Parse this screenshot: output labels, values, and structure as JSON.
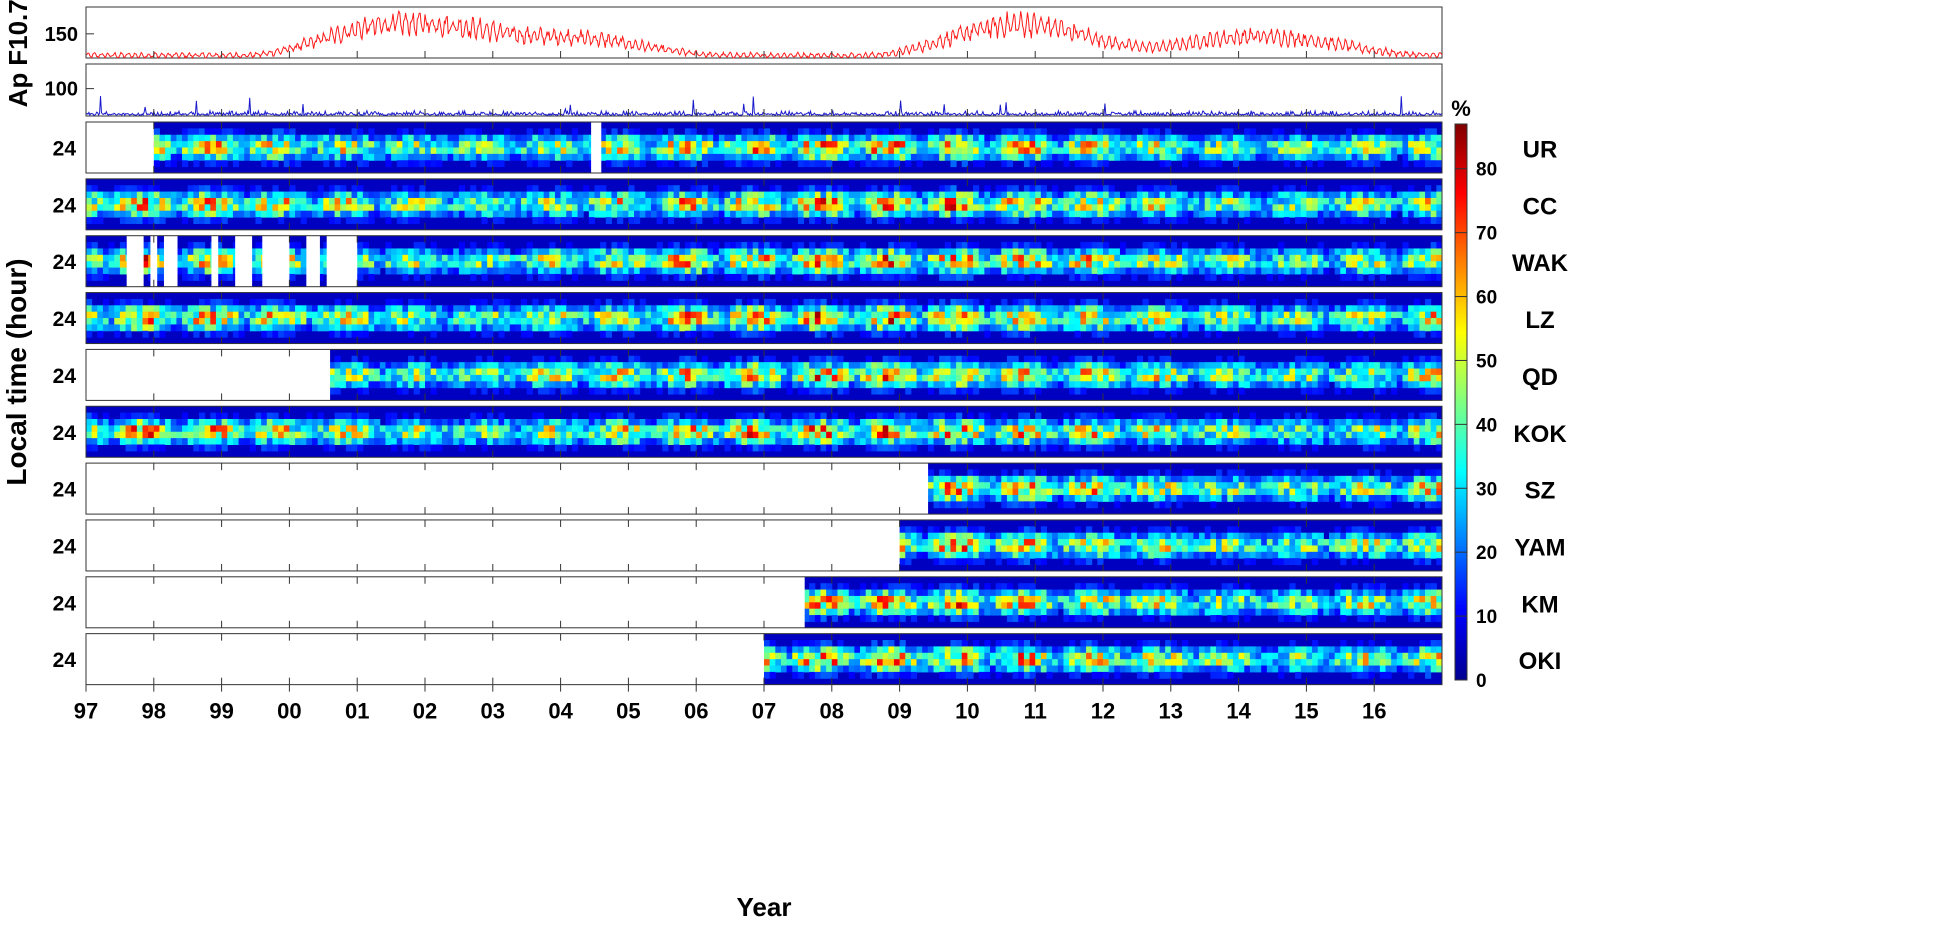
{
  "chart_data": {
    "type": "heatmap",
    "x_axis": {
      "label": "Year",
      "ticks": [
        "97",
        "98",
        "99",
        "00",
        "01",
        "02",
        "03",
        "04",
        "05",
        "06",
        "07",
        "08",
        "09",
        "10",
        "11",
        "12",
        "13",
        "14",
        "15",
        "16"
      ],
      "range": [
        1997.0,
        2017.0
      ]
    },
    "ylabel": "Local time (hour)",
    "top_panels": [
      {
        "label": "F10.7",
        "tick_label": "150",
        "tick_value": 150,
        "ylim": [
          60,
          250
        ],
        "color": "#ff1a1a"
      },
      {
        "label": "Ap",
        "tick_label": "100",
        "tick_value": 100,
        "ylim": [
          0,
          190
        ],
        "color": "#1a1acc"
      }
    ],
    "stations": [
      {
        "name": "UR",
        "tick": "24",
        "coverage": [
          [
            1997.0,
            1998.0
          ],
          [
            2004.45,
            2004.6
          ]
        ]
      },
      {
        "name": "CC",
        "tick": "24",
        "coverage": []
      },
      {
        "name": "WAK",
        "tick": "24",
        "coverage": [
          [
            1997.6,
            1997.85
          ],
          [
            1997.95,
            1998.05
          ],
          [
            1998.15,
            1998.35
          ],
          [
            1998.85,
            1998.95
          ],
          [
            1999.2,
            1999.45
          ],
          [
            1999.6,
            2000.0
          ],
          [
            2000.25,
            2000.45
          ],
          [
            2000.55,
            2001.0
          ]
        ]
      },
      {
        "name": "LZ",
        "tick": "24",
        "coverage": []
      },
      {
        "name": "QD",
        "tick": "24",
        "coverage": [
          [
            1997.0,
            2000.6
          ]
        ]
      },
      {
        "name": "KOK",
        "tick": "24",
        "coverage": []
      },
      {
        "name": "SZ",
        "tick": "24",
        "coverage": [
          [
            1997.0,
            2009.42
          ]
        ]
      },
      {
        "name": "YAM",
        "tick": "24",
        "coverage": [
          [
            1997.0,
            2009.0
          ]
        ]
      },
      {
        "name": "KM",
        "tick": "24",
        "coverage": [
          [
            1997.0,
            2007.6
          ]
        ]
      },
      {
        "name": "OKI",
        "tick": "24",
        "coverage": [
          [
            1997.0,
            2007.0
          ]
        ]
      }
    ],
    "colorbar": {
      "unit": "%",
      "ticks": [
        "0",
        "10",
        "20",
        "30",
        "40",
        "50",
        "60",
        "70",
        "80"
      ],
      "range": [
        0,
        87
      ],
      "colors": [
        "#00008f",
        "#0000ff",
        "#0080ff",
        "#00ffff",
        "#80ff80",
        "#ffff00",
        "#ff8000",
        "#ff0000",
        "#800000"
      ]
    }
  }
}
